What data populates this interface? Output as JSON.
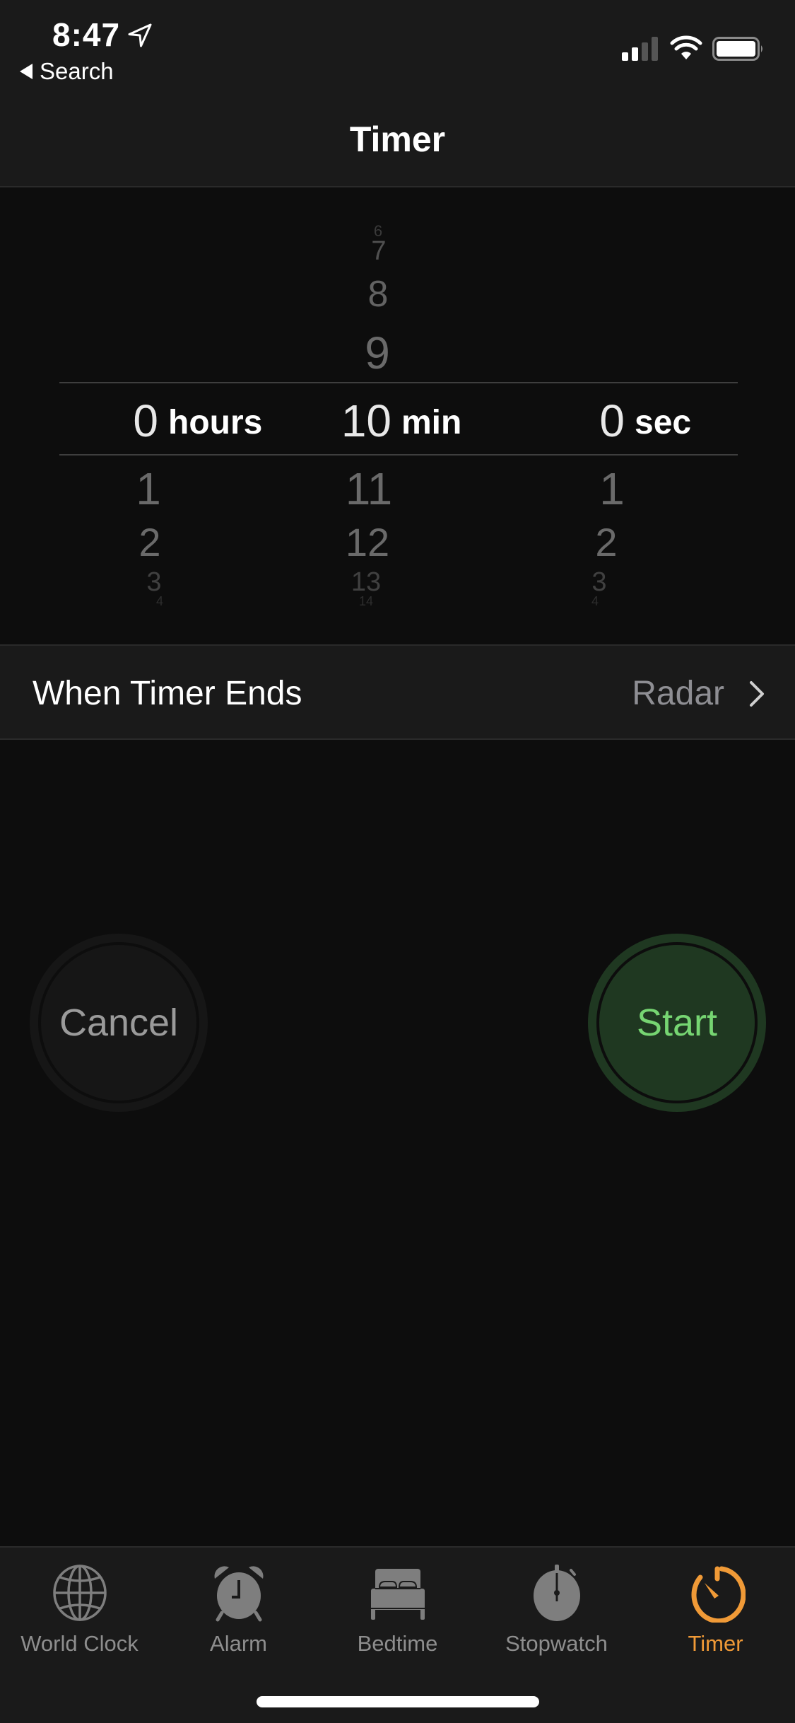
{
  "status_bar": {
    "time": "8:47",
    "location_icon": "location-arrow-icon",
    "signal_icon": "cellular-signal-icon",
    "wifi_icon": "wifi-icon",
    "battery_icon": "battery-icon"
  },
  "back_nav": {
    "label": "Search",
    "icon": "back-triangle-icon"
  },
  "header": {
    "title": "Timer"
  },
  "picker": {
    "hours": {
      "above": [],
      "selected": "0",
      "unit": "hours",
      "below": [
        "1",
        "2",
        "3",
        "4"
      ]
    },
    "minutes": {
      "above": [
        "6",
        "7",
        "8",
        "9"
      ],
      "selected": "10",
      "unit": "min",
      "below": [
        "11",
        "12",
        "13",
        "14"
      ]
    },
    "seconds": {
      "above": [],
      "selected": "0",
      "unit": "sec",
      "below": [
        "1",
        "2",
        "3",
        "4"
      ]
    }
  },
  "when_timer_ends": {
    "label": "When Timer Ends",
    "value": "Radar",
    "icon": "chevron-right-icon"
  },
  "buttons": {
    "cancel": "Cancel",
    "start": "Start"
  },
  "colors": {
    "accent": "#f09a37",
    "start_text": "#76d572",
    "start_bg": "#1f3821",
    "inactive": "#8e8e8e"
  },
  "tabbar": {
    "items": [
      {
        "label": "World Clock",
        "icon": "globe-icon",
        "active": false
      },
      {
        "label": "Alarm",
        "icon": "alarm-clock-icon",
        "active": false
      },
      {
        "label": "Bedtime",
        "icon": "bed-icon",
        "active": false
      },
      {
        "label": "Stopwatch",
        "icon": "stopwatch-icon",
        "active": false
      },
      {
        "label": "Timer",
        "icon": "timer-icon",
        "active": true
      }
    ]
  }
}
